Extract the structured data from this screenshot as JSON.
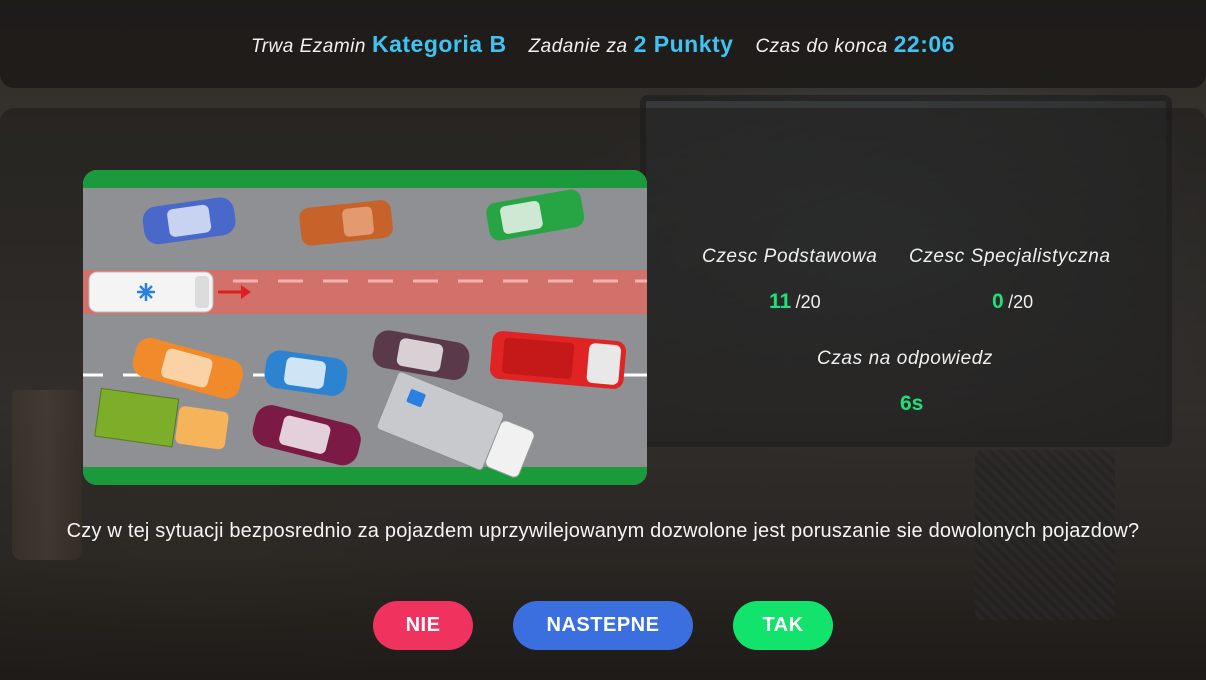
{
  "header": {
    "exam_label": "Trwa Ezamin",
    "exam_value": "Kategoria B",
    "task_label": "Zadanie za",
    "task_value": "2 Punkty",
    "time_label": "Czas do konca",
    "time_value": "22:06"
  },
  "stats": {
    "basic_label": "Czesc Podstawowa",
    "basic_score": "11",
    "basic_total": "/20",
    "special_label": "Czesc Specjalistyczna",
    "special_score": "0",
    "special_total": "/20",
    "answer_time_label": "Czas na odpowiedz",
    "answer_time_value": "6s"
  },
  "question": {
    "text": "Czy w tej sytuacji bezposrednio za pojazdem uprzywilejowanym dozwolone jest poruszanie sie dowolonych pojazdow?"
  },
  "buttons": {
    "no": "NIE",
    "next": "NASTEPNE",
    "yes": "TAK"
  },
  "colors": {
    "accent_blue": "#3ec3f2",
    "score_green": "#21e07a",
    "no_button": "#f0325f",
    "next_button": "#3b6fe0",
    "yes_button": "#12e36c"
  }
}
